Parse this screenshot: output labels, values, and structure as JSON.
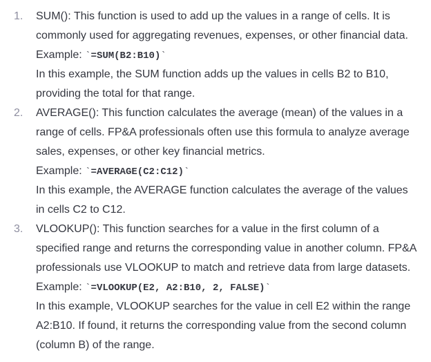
{
  "items": [
    {
      "title": "SUM(): This function is used to add up the values in a range of cells. It is commonly used for aggregating revenues, expenses, or other financial data.",
      "example_label": "Example: ",
      "code": "=SUM(B2:B10)",
      "explanation": "In this example, the SUM function adds up the values in cells B2 to B10, providing the total for that range."
    },
    {
      "title": "AVERAGE(): This function calculates the average (mean) of the values in a range of cells. FP&A professionals often use this formula to analyze average sales, expenses, or other key financial metrics.",
      "example_label": "Example: ",
      "code": "=AVERAGE(C2:C12)",
      "explanation": "In this example, the AVERAGE function calculates the average of the values in cells C2 to C12."
    },
    {
      "title": "VLOOKUP(): This function searches for a value in the first column of a specified range and returns the corresponding value in another column. FP&A professionals use VLOOKUP to match and retrieve data from large datasets.",
      "example_label": "Example: ",
      "code": "=VLOOKUP(E2, A2:B10, 2, FALSE)",
      "explanation": "In this example, VLOOKUP searches for the value in cell E2 within the range A2:B10. If found, it returns the corresponding value from the second column (column B) of the range."
    }
  ]
}
